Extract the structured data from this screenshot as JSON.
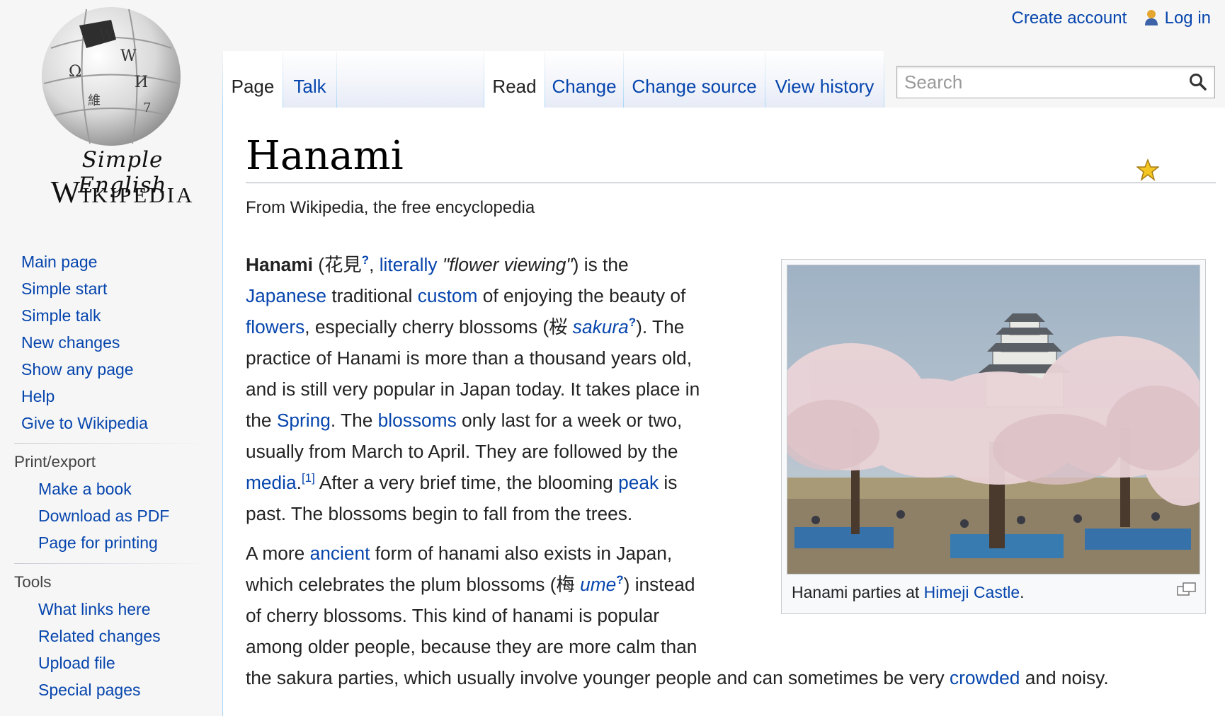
{
  "logo": {
    "line1": "Simple English",
    "line2": "Wikipedia"
  },
  "personal": {
    "create_account": "Create account",
    "log_in": "Log in"
  },
  "tabs": {
    "page": "Page",
    "talk": "Talk",
    "read": "Read",
    "change": "Change",
    "change_source": "Change source",
    "view_history": "View history"
  },
  "search": {
    "placeholder": "Search"
  },
  "sidebar": {
    "main": [
      "Main page",
      "Simple start",
      "Simple talk",
      "New changes",
      "Show any page",
      "Help",
      "Give to Wikipedia"
    ],
    "print_export": {
      "heading": "Print/export",
      "items": [
        "Make a book",
        "Download as PDF",
        "Page for printing"
      ]
    },
    "tools": {
      "heading": "Tools",
      "items": [
        "What links here",
        "Related changes",
        "Upload file",
        "Special pages"
      ]
    }
  },
  "article": {
    "title": "Hanami",
    "subtitle": "From Wikipedia, the free encyclopedia",
    "p1": {
      "term": "Hanami",
      "kanji1": "花見",
      "q": "?",
      "literally": "literally",
      "meaning": "\"flower viewing\"",
      "is_the": ") is the",
      "japanese": "Japanese",
      "traditional": " traditional ",
      "custom": "custom",
      "enjoying": " of enjoying the beauty of",
      "flowers": "flowers",
      "especially": ", especially cherry blossoms (桜 ",
      "sakura": "sakura",
      "the": "). The",
      "line4": "practice of Hanami is more than a thousand years old,",
      "line5": "and is still very popular in Japan today. It takes place in",
      "the_pre": "the ",
      "spring": "Spring",
      "the_mid": ". The ",
      "blossoms": "blossoms",
      "only_last": " only last for a week or two,",
      "line7": "usually from March to April. They are followed by the",
      "media": "media",
      "ref1": "[1]",
      "after": " After a very brief time, the blooming ",
      "peak": "peak",
      "is": " is",
      "line9": "past. The blossoms begin to fall from the trees."
    },
    "p2": {
      "a_more": "A more ",
      "ancient": "ancient",
      "form": " form of hanami also exists in Japan,",
      "which": "which celebrates the plum blossoms (梅 ",
      "ume": "ume",
      "instead": ") instead",
      "line3": "of cherry blossoms. This kind of hanami is popular",
      "line4": "among older people, because they are more calm than",
      "line5a": "the sakura parties, which usually involve younger people and can sometimes be very ",
      "crowded": "crowded",
      "line5b": " and noisy."
    },
    "thumb": {
      "caption_pre": "Hanami parties at ",
      "caption_link": "Himeji Castle",
      "caption_post": "."
    }
  }
}
